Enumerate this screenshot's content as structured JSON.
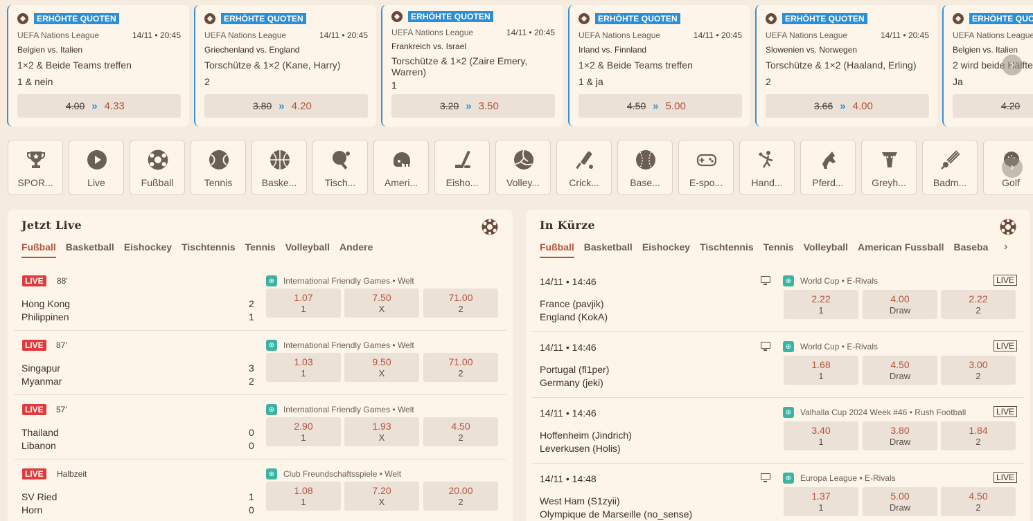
{
  "boost_badge": "ERHÖHTE QUOTEN",
  "boosts": [
    {
      "league": "UEFA Nations League",
      "time": "14/11 • 20:45",
      "match": "Belgien vs. Italien",
      "market": "1×2 & Beide Teams treffen",
      "selection": "1 & nein",
      "old": "4.00",
      "new": "4.33"
    },
    {
      "league": "UEFA Nations League",
      "time": "14/11 • 20:45",
      "match": "Griechenland vs. England",
      "market": "Torschütze & 1×2 (Kane, Harry)",
      "selection": "2",
      "old": "3.80",
      "new": "4.20"
    },
    {
      "league": "UEFA Nations League",
      "time": "14/11 • 20:45",
      "match": "Frankreich vs. Israel",
      "market": "Torschütze & 1×2 (Zaire Emery, Warren)",
      "selection": "1",
      "old": "3.20",
      "new": "3.50"
    },
    {
      "league": "UEFA Nations League",
      "time": "14/11 • 20:45",
      "match": "Irland vs. Finnland",
      "market": "1×2 & Beide Teams treffen",
      "selection": "1 & ja",
      "old": "4.50",
      "new": "5.00"
    },
    {
      "league": "UEFA Nations League",
      "time": "14/11 • 20:45",
      "match": "Slowenien vs. Norwegen",
      "market": "Torschütze & 1×2 (Haaland, Erling)",
      "selection": "2",
      "old": "3.66",
      "new": "4.00"
    },
    {
      "league": "UEFA Nations League",
      "time": "",
      "match": "Belgien vs. Italien",
      "market": "2 wird beide Hälfte",
      "selection": "Ja",
      "old": "4.20",
      "new": ""
    }
  ],
  "sports": [
    {
      "label": "SPOR...",
      "icon": "trophy-icon"
    },
    {
      "label": "Live",
      "icon": "play-icon"
    },
    {
      "label": "Fußball",
      "icon": "soccer-ball-icon"
    },
    {
      "label": "Tennis",
      "icon": "tennis-ball-icon"
    },
    {
      "label": "Baske...",
      "icon": "basketball-icon"
    },
    {
      "label": "Tisch...",
      "icon": "table-tennis-icon"
    },
    {
      "label": "Ameri...",
      "icon": "football-helmet-icon"
    },
    {
      "label": "Eisho...",
      "icon": "hockey-stick-icon"
    },
    {
      "label": "Volley...",
      "icon": "volleyball-icon"
    },
    {
      "label": "Crick...",
      "icon": "cricket-bat-icon"
    },
    {
      "label": "Base...",
      "icon": "baseball-icon"
    },
    {
      "label": "E-spo...",
      "icon": "gamepad-icon"
    },
    {
      "label": "Hand...",
      "icon": "handball-icon"
    },
    {
      "label": "Pferd...",
      "icon": "horse-icon"
    },
    {
      "label": "Greyh...",
      "icon": "greyhound-icon"
    },
    {
      "label": "Badm...",
      "icon": "shuttlecock-icon"
    },
    {
      "label": "Golf",
      "icon": "golf-icon"
    }
  ],
  "live": {
    "title": "Jetzt Live",
    "tabs": [
      "Fußball",
      "Basketball",
      "Eishockey",
      "Tischtennis",
      "Tennis",
      "Volleyball",
      "Andere"
    ],
    "live_label": "LIVE",
    "matches": [
      {
        "minute": "88'",
        "comp": "International Friendly Games • Welt",
        "home": "Hong Kong",
        "away": "Philippinen",
        "hs": "2",
        "as": "1",
        "o1": "1.07",
        "ox": "7.50",
        "o2": "71.00"
      },
      {
        "minute": "87'",
        "comp": "International Friendly Games • Welt",
        "home": "Singapur",
        "away": "Myanmar",
        "hs": "3",
        "as": "2",
        "o1": "1.03",
        "ox": "9.50",
        "o2": "71.00"
      },
      {
        "minute": "57'",
        "comp": "International Friendly Games • Welt",
        "home": "Thailand",
        "away": "Libanon",
        "hs": "0",
        "as": "0",
        "o1": "2.90",
        "ox": "1.93",
        "o2": "4.50"
      },
      {
        "minute": "Halbzeit",
        "comp": "Club Freundschaftsspiele • Welt",
        "home": "SV Ried",
        "away": "Horn",
        "hs": "1",
        "as": "0",
        "o1": "1.08",
        "ox": "7.20",
        "o2": "20.00"
      }
    ],
    "labels": {
      "one": "1",
      "x": "X",
      "two": "2"
    }
  },
  "soon": {
    "title": "In Kürze",
    "tabs": [
      "Fußball",
      "Basketball",
      "Eishockey",
      "Tischtennis",
      "Tennis",
      "Volleyball",
      "American Fussball",
      "Baseba"
    ],
    "live_box": "LIVE",
    "matches": [
      {
        "time": "14/11 • 14:46",
        "comp": "World Cup • E-Rivals",
        "home": "France (pavjik)",
        "away": "England (KokA)",
        "o1": "2.22",
        "ox": "4.00",
        "o2": "2.22",
        "tv": true
      },
      {
        "time": "14/11 • 14:46",
        "comp": "World Cup • E-Rivals",
        "home": "Portugal (fl1per)",
        "away": "Germany (jeki)",
        "o1": "1.68",
        "ox": "4.50",
        "o2": "3.00",
        "tv": true
      },
      {
        "time": "14/11 • 14:46",
        "comp": "Valhalla Cup 2024 Week #46 • Rush Football",
        "home": "Hoffenheim (Jindrich)",
        "away": "Leverkusen (Holis)",
        "o1": "3.40",
        "ox": "3.80",
        "o2": "1.84",
        "tv": false
      },
      {
        "time": "14/11 • 14:48",
        "comp": "Europa League • E-Rivals",
        "home": "West Ham (S1zyii)",
        "away": "Olympique de Marseille (no_sense)",
        "o1": "1.37",
        "ox": "5.00",
        "o2": "4.50",
        "tv": true
      }
    ],
    "labels": {
      "one": "1",
      "x": "Draw",
      "two": "2"
    }
  }
}
